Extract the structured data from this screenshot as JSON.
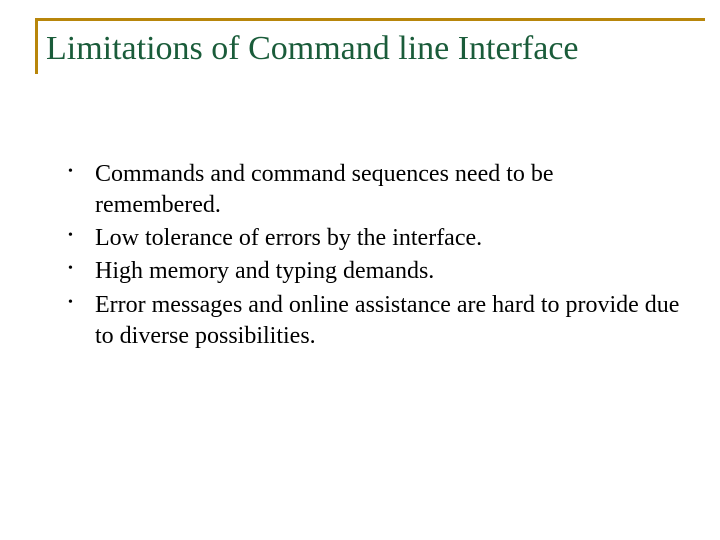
{
  "slide": {
    "title": "Limitations of Command line Interface",
    "bullets": [
      "Commands and command sequences need to be remembered.",
      "Low tolerance of errors by the interface.",
      "High memory and typing demands.",
      "Error messages and online assistance are hard to provide due to diverse possibilities."
    ]
  }
}
